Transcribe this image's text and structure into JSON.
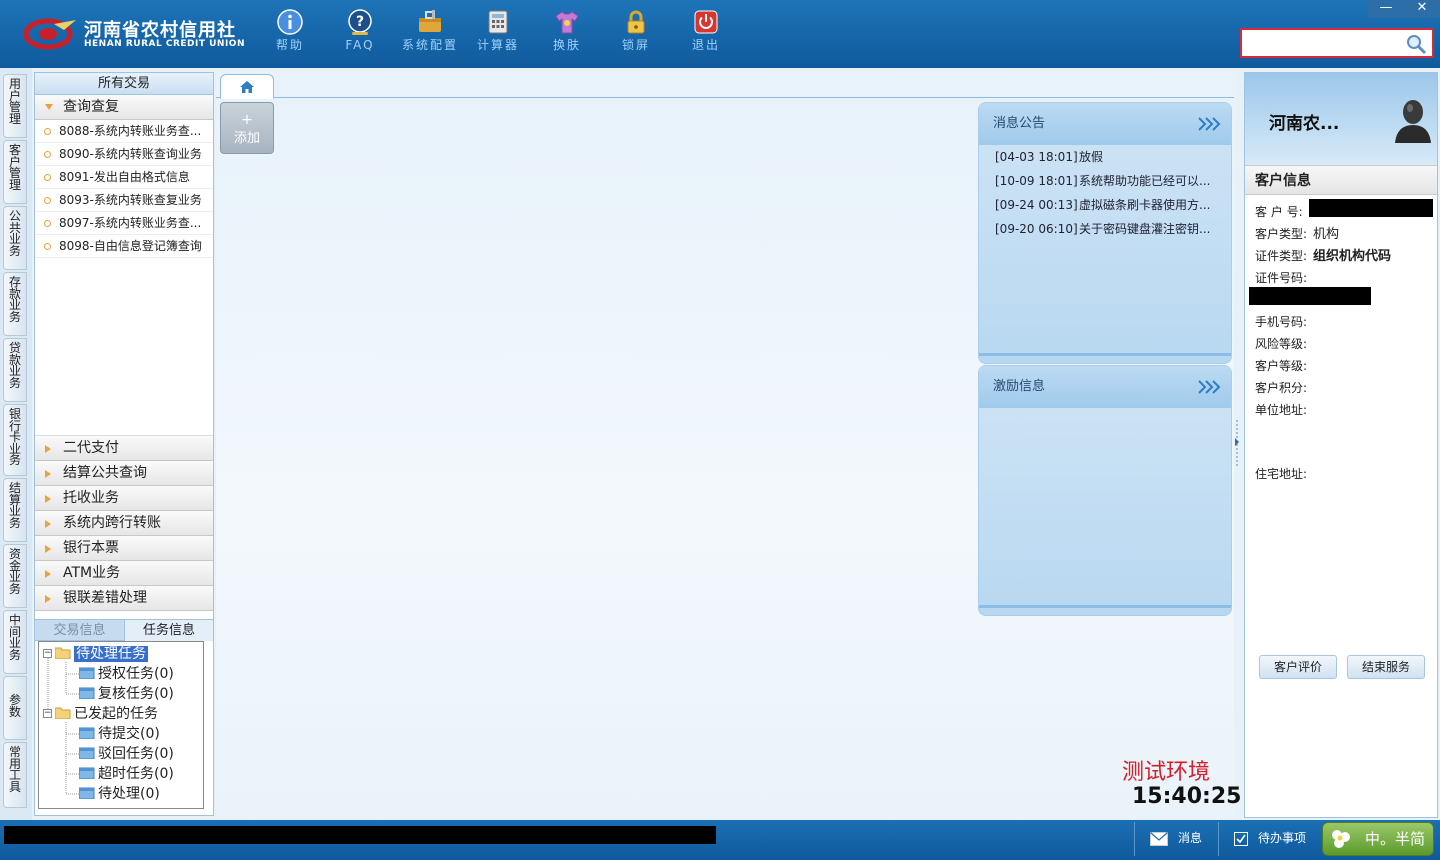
{
  "window": {
    "minimize_label": "—",
    "close_label": "✕"
  },
  "logo": {
    "name_cn": "河南省农村信用社",
    "name_en": "HENAN RURAL CREDIT UNION"
  },
  "toolbar": {
    "help": "帮助",
    "faq": "FAQ",
    "config": "系统配置",
    "calculator": "计算器",
    "skin": "换肤",
    "lock": "锁屏",
    "exit": "退出"
  },
  "search": {
    "value": "",
    "placeholder": ""
  },
  "vertical_tabs": [
    "用户管理",
    "客户管理",
    "公共业务",
    "存款业务",
    "贷款业务",
    "银行卡业务",
    "结算业务",
    "资金业务",
    "中间业务",
    "参数",
    "常用工具"
  ],
  "nav": {
    "title": "所有交易",
    "open_group": "查询查复",
    "transactions": [
      "8088-系统内转账业务查...",
      "8090-系统内转账查询业务",
      "8091-发出自由格式信息",
      "8093-系统内转账查复业务",
      "8097-系统内转账业务查...",
      "8098-自由信息登记簿查询"
    ],
    "groups": [
      "二代支付",
      "结算公共查询",
      "托收业务",
      "系统内跨行转账",
      "银行本票",
      "ATM业务",
      "银联差错处理"
    ]
  },
  "task_tabs": {
    "trade_info": "交易信息",
    "task_info": "任务信息"
  },
  "task_tree": {
    "pending": "待处理任务",
    "authorize": "授权任务(0)",
    "review": "复核任务(0)",
    "initiated": "已发起的任务",
    "to_submit": "待提交(0)",
    "rejected": "驳回任务(0)",
    "timeout": "超时任务(0)",
    "to_process": "待处理(0)"
  },
  "main": {
    "add_plus": "+",
    "add_label": "添加"
  },
  "notice_panel": {
    "title": "消息公告",
    "items": [
      {
        "date": "[04-03 18:01]",
        "text": "放假"
      },
      {
        "date": "[10-09 18:01]",
        "text": "系统帮助功能已经可以..."
      },
      {
        "date": "[09-24 00:13]",
        "text": "虚拟磁条刷卡器使用方..."
      },
      {
        "date": "[09-20 06:10]",
        "text": "关于密码键盘灌注密钥..."
      }
    ]
  },
  "incentive_panel": {
    "title": "激励信息"
  },
  "env": {
    "label": "测试环境",
    "time": "15:40:25"
  },
  "customer": {
    "name": "河南农...",
    "header": "客户信息",
    "id_label": "客 户 号:",
    "type_label": "客户类型:",
    "type_value": "机构",
    "cert_type_label": "证件类型:",
    "cert_type_value": "组织机构代码",
    "cert_no_label": "证件号码:",
    "phone_label": "手机号码:",
    "risk_label": "风险等级:",
    "level_label": "客户等级:",
    "points_label": "客户积分:",
    "company_addr_label": "单位地址:",
    "home_addr_label": "住宅地址:",
    "evaluate_button": "客户评价",
    "end_button": "结束服务"
  },
  "statusbar": {
    "message": "消息",
    "todo": "待办事项",
    "ime": "中。半简"
  },
  "colors": {
    "header_blue": "#1e74b8",
    "env_red": "#d41f2a",
    "accent_orange": "#e8a33b"
  }
}
